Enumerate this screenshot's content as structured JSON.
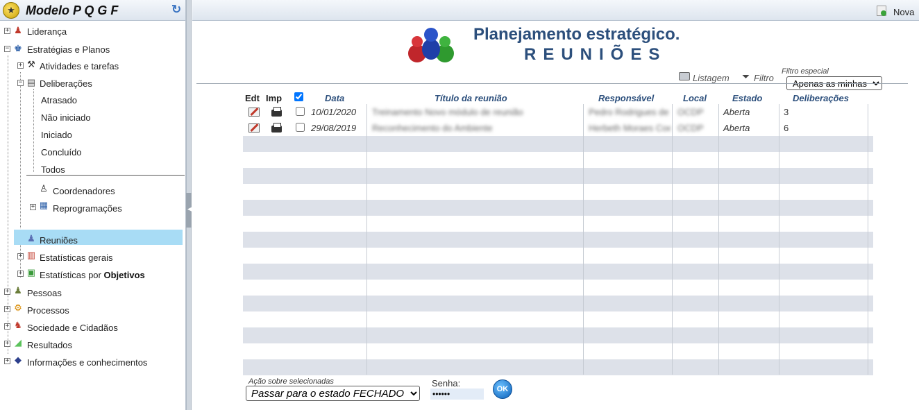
{
  "sidebar": {
    "title": "Modelo P Q G F",
    "items": {
      "lideranca": "Liderança",
      "estrategias": "Estratégias e Planos",
      "atividades": "Atividades e tarefas",
      "deliberacoes": "Deliberações",
      "atrasado": "Atrasado",
      "nao_iniciado": "Não iniciado",
      "iniciado": "Iniciado",
      "concluido": "Concluído",
      "todos": "Todos",
      "coordenadores": "Coordenadores",
      "reprogramacoes": "Reprogramações",
      "reunioes": "Reuniões",
      "estatisticas_gerais": "Estatísticas gerais",
      "estatisticas_por": "Estatísticas por",
      "objetivos": "Objetivos",
      "pessoas": "Pessoas",
      "processos": "Processos",
      "sociedade": "Sociedade e Cidadãos",
      "resultados": "Resultados",
      "informacoes": "Informações e conhecimentos"
    }
  },
  "header": {
    "nova_label": "Nova"
  },
  "page": {
    "title": "Planejamento estratégico.",
    "subtitle": "REUNIÕES"
  },
  "toolbar": {
    "listagem": "Listagem",
    "filtro": "Filtro",
    "filtro_especial_label": "Filtro especial",
    "filtro_especial_value": "Apenas as minhas"
  },
  "table": {
    "headers": {
      "edt": "Edt",
      "imp": "Imp",
      "data": "Data",
      "titulo": "Título da reunião",
      "responsavel": "Responsável",
      "local": "Local",
      "estado": "Estado",
      "deliberacoes": "Deliberações"
    },
    "rows": [
      {
        "data": "10/01/2020",
        "titulo": "Treinamento Novo módulo de reunião",
        "responsavel": "Pedro Rodrigues de",
        "local": "OCDP",
        "estado": "Aberta",
        "deliberacoes": "3"
      },
      {
        "data": "29/08/2019",
        "titulo": "Reconhecimento do Ambiente",
        "responsavel": "Herbeth Moraes Coe",
        "local": "OCDP",
        "estado": "Aberta",
        "deliberacoes": "6"
      }
    ]
  },
  "footer": {
    "acao_label": "Ação sobre selecionadas",
    "acao_value": "Passar para o estado FECHADO",
    "senha_label": "Senha:",
    "senha_value": "••••••",
    "ok_label": "OK"
  },
  "colors": {
    "accent": "#2c4f7c",
    "highlight": "#a8dcf5",
    "row_shade": "#dde1e9"
  }
}
